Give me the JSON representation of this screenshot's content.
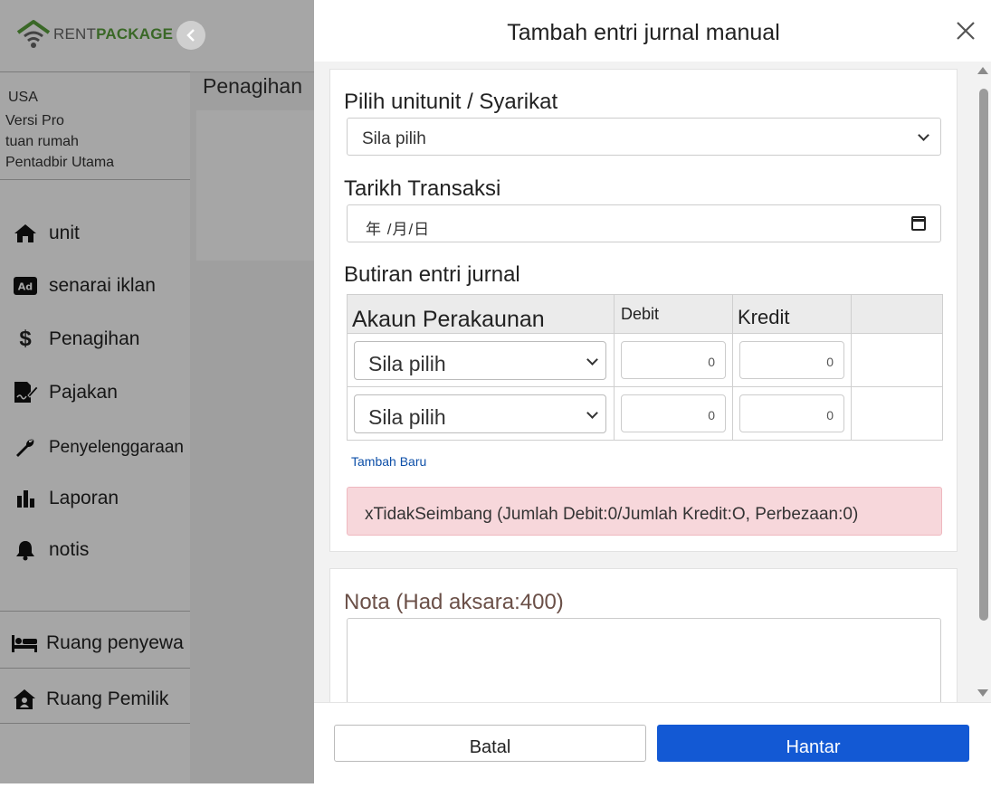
{
  "brand": {
    "logo_rent": "RENT",
    "logo_package": "PACKAGE"
  },
  "sidebar": {
    "collapse_icon": "chevron-left-icon",
    "info": {
      "country": "USA",
      "version": "Versi Pro",
      "role": "tuan rumah",
      "admin": "Pentadbir Utama"
    },
    "nav": [
      {
        "label": "unit",
        "icon": "home-icon"
      },
      {
        "label": "senarai iklan",
        "icon": "ad-icon"
      },
      {
        "label": "Penagihan",
        "icon": "dollar-icon"
      },
      {
        "label": "Pajakan",
        "icon": "contract-sign-icon"
      },
      {
        "label": "Penyelenggaraan",
        "icon": "wrench-icon"
      },
      {
        "label": "Laporan",
        "icon": "bar-chart-icon"
      },
      {
        "label": "notis",
        "icon": "bell-icon"
      }
    ],
    "bottom": [
      {
        "label": "Ruang penyewa",
        "icon": "bed-icon"
      },
      {
        "label": "Ruang Pemilik",
        "icon": "house-user-icon"
      }
    ]
  },
  "background_page": {
    "title": "Penagihan"
  },
  "modal": {
    "title": "Tambah entri jurnal manual",
    "close_icon": "close-icon",
    "unit_label": "Pilih unitunit / Syarikat",
    "unit_select_value": "Sila pilih",
    "date_label": "Tarikh Transaksi",
    "date_placeholder": "年 /月/日",
    "entries_label": "Butiran entri jurnal",
    "table": {
      "headers": {
        "account": "Akaun Perakaunan",
        "debit": "Debit",
        "credit": "Kredit",
        "extra": ""
      },
      "rows": [
        {
          "account": "Sila pilih",
          "debit": "0",
          "credit": "0"
        },
        {
          "account": "Sila pilih",
          "debit": "0",
          "credit": "0"
        }
      ]
    },
    "add_new_link": "Tambah Baru",
    "alert_message": "xTidakSeimbang (Jumlah Debit:0/Jumlah Kredit:O, Perbezaan:0)",
    "note_label": "Nota (Had aksara:400)",
    "note_value": "",
    "cancel_button": "Batal",
    "submit_button": "Hantar"
  },
  "colors": {
    "primary": "#1359d4",
    "brand_green": "#5aa03c",
    "alert_bg": "#f7d7db",
    "link": "#0d4fa8"
  }
}
